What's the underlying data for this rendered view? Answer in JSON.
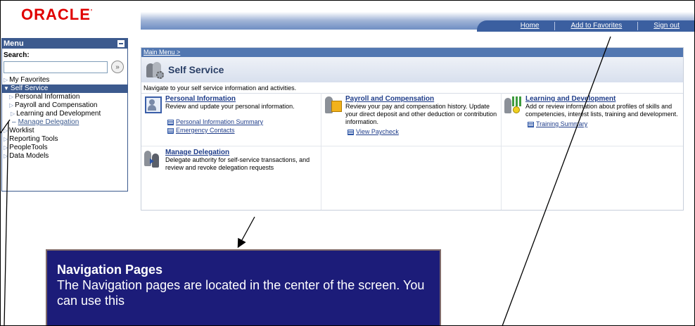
{
  "header": {
    "logo": "ORACLE",
    "nav": [
      "Home",
      "Add to Favorites",
      "Sign out"
    ]
  },
  "menu": {
    "title": "Menu",
    "search_label": "Search:",
    "search_value": "",
    "items": [
      {
        "label": "My Favorites"
      },
      {
        "label": "Self Service"
      },
      {
        "label": "Personal Information"
      },
      {
        "label": "Payroll and Compensation"
      },
      {
        "label": "Learning and Development"
      },
      {
        "label": "Manage Delegation"
      },
      {
        "label": "Worklist"
      },
      {
        "label": "Reporting Tools"
      },
      {
        "label": "PeopleTools"
      },
      {
        "label": "Data Models"
      }
    ]
  },
  "main": {
    "breadcrumb": "Main Menu >",
    "title": "Self Service",
    "intro": "Navigate to your self service information and activities.",
    "categories": [
      {
        "title": "Personal Information",
        "desc": "Review and update your personal information.",
        "icon": "personal-info-icon",
        "links": [
          "Personal Information Summary",
          "Emergency Contacts"
        ]
      },
      {
        "title": "Payroll and Compensation",
        "desc": "Review your pay and compensation history. Update your direct deposit and other deduction or contribution information.",
        "icon": "payroll-icon",
        "links": [
          "View Paycheck"
        ]
      },
      {
        "title": "Learning and Development",
        "desc": "Add or review information about profiles of skills and competencies, interest lists, training and development.",
        "icon": "learning-icon",
        "links": [
          "Training Summary"
        ]
      },
      {
        "title": "Manage Delegation",
        "desc": "Delegate authority for self-service transactions, and review and revoke delegation requests",
        "icon": "delegation-icon",
        "links": []
      }
    ]
  },
  "callout": {
    "title": "Navigation Pages",
    "text": "The Navigation pages are located in the center of the screen.  You can use this"
  },
  "colors": {
    "brand_red": "#e00000",
    "menu_blue": "#3c5a8e",
    "callout_navy": "#1c1c79",
    "link_blue": "#1f3d8a"
  }
}
